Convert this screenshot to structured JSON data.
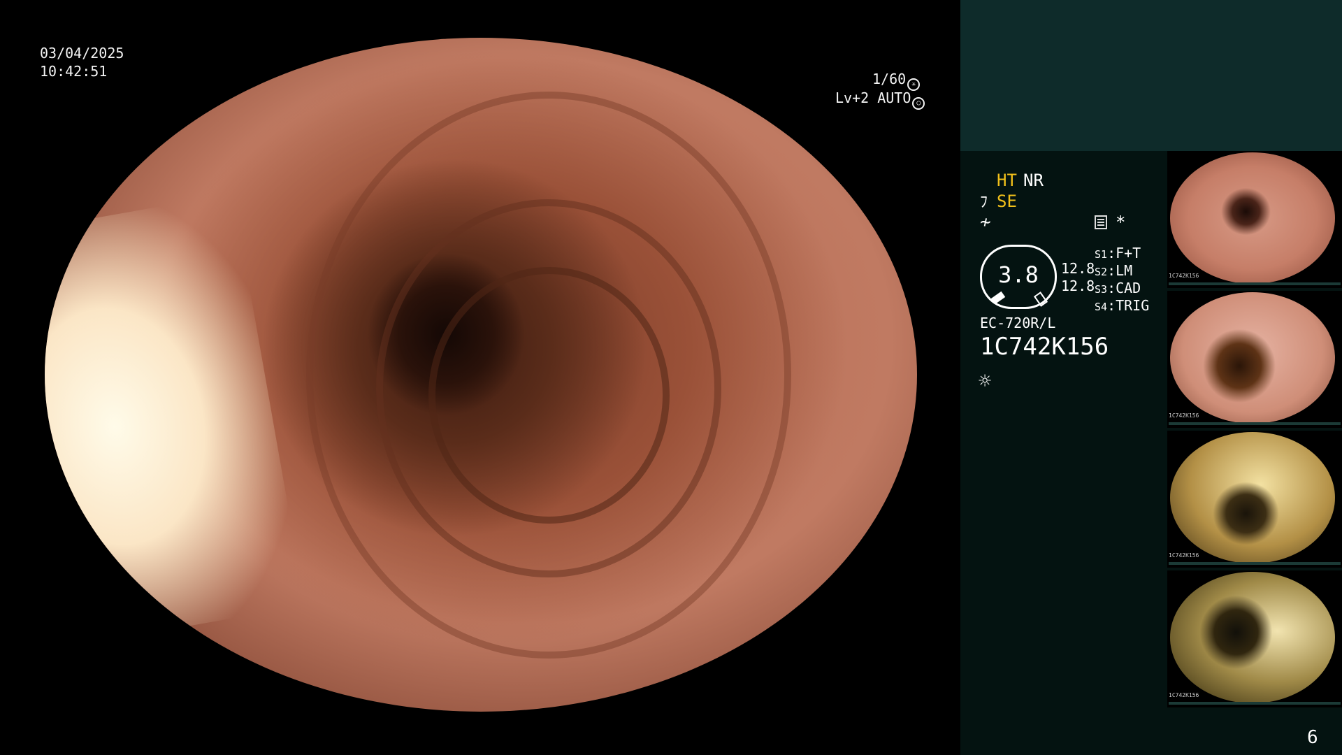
{
  "overlay": {
    "date": "03/04/2025",
    "time": "10:42:51",
    "shutter": "1/60",
    "level": "Lv+2 AUTO"
  },
  "panel": {
    "ht": "HT",
    "nr": "NR",
    "se": "SE",
    "gauge_value": "3.8",
    "val_top": "12.8",
    "val_bottom": "12.8",
    "s1_key": "S1",
    "s1_val": ":F+T",
    "s2_key": "S2",
    "s2_val": ":LM",
    "s3_key": "S3",
    "s3_val": ":CAD",
    "s4_key": "S4",
    "s4_val": ":TRIG",
    "model": "EC-720R/L",
    "serial": "1C742K156",
    "accent_color": "#f2c01a"
  },
  "thumbnails": [
    {
      "label": "1C742K156"
    },
    {
      "label": "1C742K156"
    },
    {
      "label": "1C742K156"
    },
    {
      "label": "1C742K156"
    }
  ],
  "page_number": "6",
  "icons": [
    "shutter-icon",
    "auto-icon",
    "scope-icon",
    "freeze-icon",
    "document-icon",
    "star-icon",
    "light-icon"
  ]
}
